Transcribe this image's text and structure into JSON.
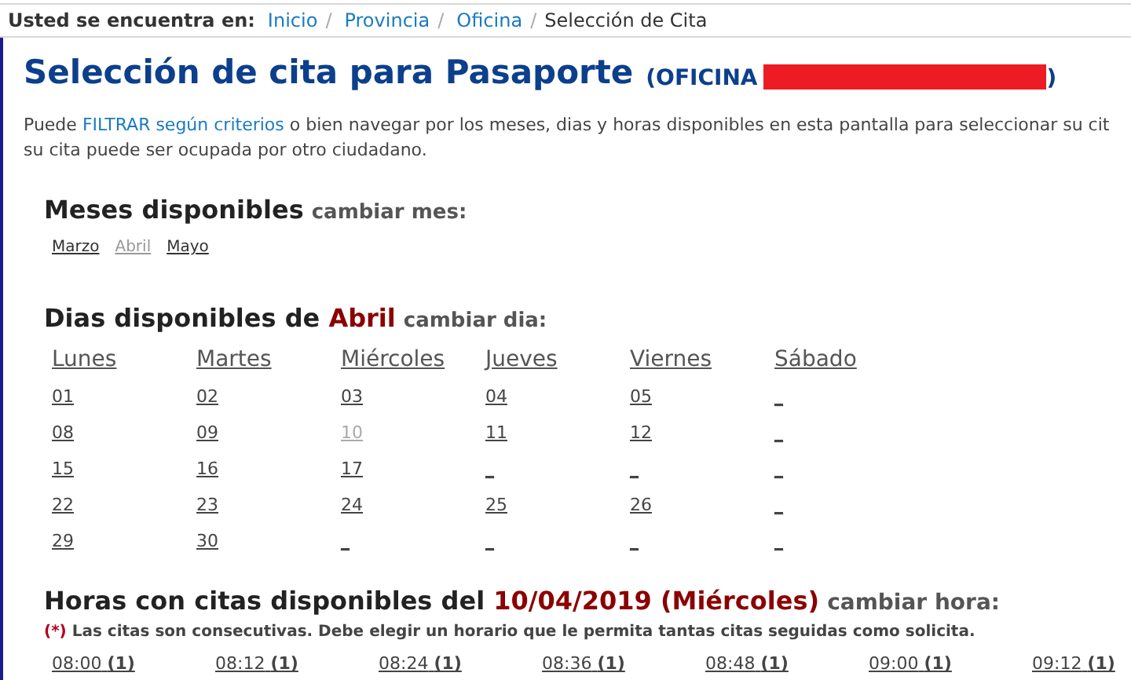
{
  "breadcrumb": {
    "label": "Usted se encuentra en:",
    "items": [
      {
        "text": "Inicio",
        "link": true
      },
      {
        "text": "Provincia",
        "link": true
      },
      {
        "text": "Oficina",
        "link": true
      },
      {
        "text": "Selección de Cita",
        "link": false
      }
    ],
    "separator": "/"
  },
  "title": {
    "main": "Selección de cita para Pasaporte",
    "office_prefix": "(OFICINA",
    "office_suffix": ")"
  },
  "intro": {
    "before": "Puede ",
    "link": "FILTRAR según criterios",
    "after": " o bien navegar por los meses, dias y horas disponibles en esta pantalla para seleccionar su cit",
    "line2": "su cita puede ser ocupada por otro ciudadano."
  },
  "months": {
    "heading": "Meses disponibles",
    "change": "cambiar mes:",
    "items": [
      {
        "label": "Marzo",
        "selected": false
      },
      {
        "label": "Abril",
        "selected": true
      },
      {
        "label": "Mayo",
        "selected": false
      }
    ]
  },
  "days": {
    "heading": "Dias disponibles de",
    "month": "Abril",
    "change": "cambiar dia:",
    "columns": [
      "Lunes",
      "Martes",
      "Miércoles",
      "Jueves",
      "Viernes",
      "Sábado"
    ],
    "rows": [
      [
        {
          "label": "01",
          "selected": false
        },
        {
          "label": "02",
          "selected": false
        },
        {
          "label": "03",
          "selected": false
        },
        {
          "label": "04",
          "selected": false
        },
        {
          "label": "05",
          "selected": false
        },
        {
          "label": "_",
          "selected": false
        }
      ],
      [
        {
          "label": "08",
          "selected": false
        },
        {
          "label": "09",
          "selected": false
        },
        {
          "label": "10",
          "selected": true
        },
        {
          "label": "11",
          "selected": false
        },
        {
          "label": "12",
          "selected": false
        },
        {
          "label": "_",
          "selected": false
        }
      ],
      [
        {
          "label": "15",
          "selected": false
        },
        {
          "label": "16",
          "selected": false
        },
        {
          "label": "17",
          "selected": false
        },
        {
          "label": "_",
          "selected": false
        },
        {
          "label": "_",
          "selected": false
        },
        {
          "label": "_",
          "selected": false
        }
      ],
      [
        {
          "label": "22",
          "selected": false
        },
        {
          "label": "23",
          "selected": false
        },
        {
          "label": "24",
          "selected": false
        },
        {
          "label": "25",
          "selected": false
        },
        {
          "label": "26",
          "selected": false
        },
        {
          "label": "_",
          "selected": false
        }
      ],
      [
        {
          "label": "29",
          "selected": false
        },
        {
          "label": "30",
          "selected": false
        },
        {
          "label": "_",
          "selected": false
        },
        {
          "label": "_",
          "selected": false
        },
        {
          "label": "_",
          "selected": false
        },
        {
          "label": "_",
          "selected": false
        }
      ]
    ]
  },
  "hours": {
    "heading": "Horas con citas disponibles del",
    "date": "10/04/2019 (Miércoles)",
    "change": "cambiar hora:",
    "note_mark": "(*)",
    "note": "Las citas son consecutivas. Debe elegir un horario que le permita tantas citas seguidas como solicita.",
    "slots": [
      {
        "time": "08:00",
        "count": "(1)"
      },
      {
        "time": "08:12",
        "count": "(1)"
      },
      {
        "time": "08:24",
        "count": "(1)"
      },
      {
        "time": "08:36",
        "count": "(1)"
      },
      {
        "time": "08:48",
        "count": "(1)"
      },
      {
        "time": "09:00",
        "count": "(1)"
      },
      {
        "time": "09:12",
        "count": "(1)"
      }
    ]
  }
}
